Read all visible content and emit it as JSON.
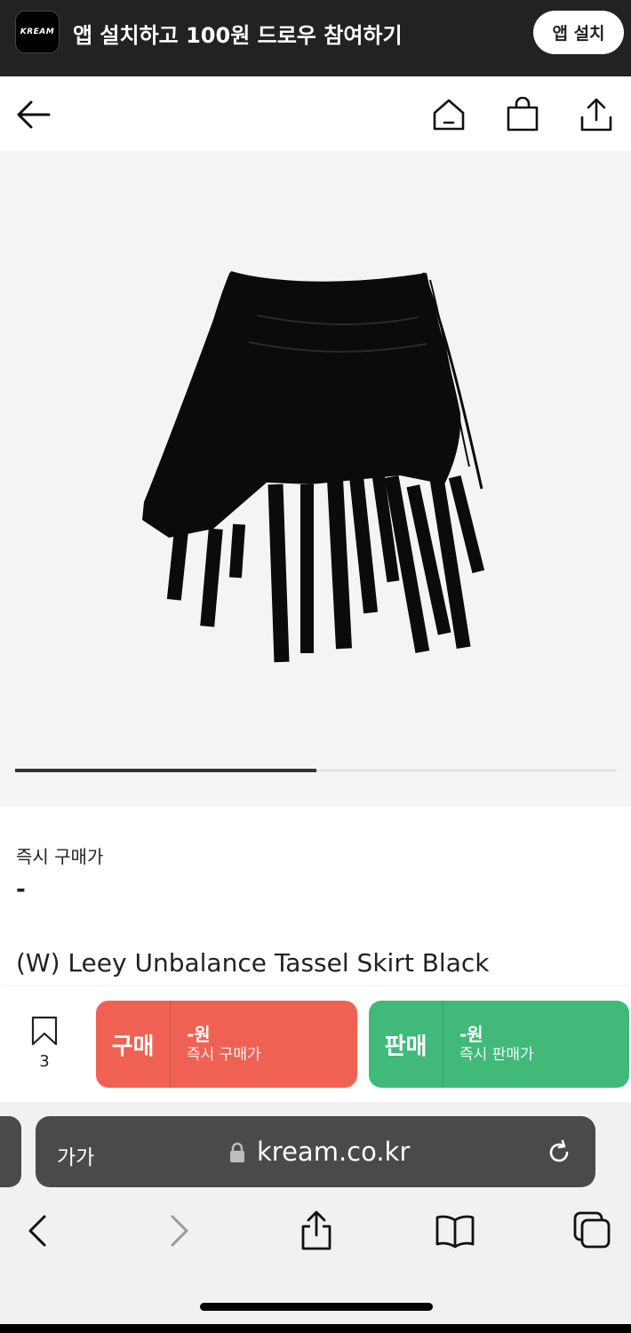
{
  "banner": {
    "logo_text": "KREAM",
    "message": "앱 설치하고 100원 드로우 참여하기",
    "install_label": "앱 설치"
  },
  "nav": {
    "icons": [
      "back-arrow-icon",
      "home-icon",
      "shopping-bag-icon",
      "share-icon"
    ]
  },
  "gallery": {
    "image": "black-tassel-skirt-photo",
    "progress": 0.5
  },
  "product": {
    "price_label": "즉시 구매가",
    "price_value": "-",
    "title": "(W) Leey Unbalance Tassel Skirt Black"
  },
  "actions": {
    "wish_count": "3",
    "buy": {
      "label": "구매",
      "price": "-원",
      "caption": "즉시 구매가",
      "color": "#ef6253"
    },
    "sell": {
      "label": "판매",
      "price": "-원",
      "caption": "즉시 판매가",
      "color": "#41b979"
    }
  },
  "browser": {
    "aa_label": "가가",
    "url": "kream.co.kr"
  }
}
